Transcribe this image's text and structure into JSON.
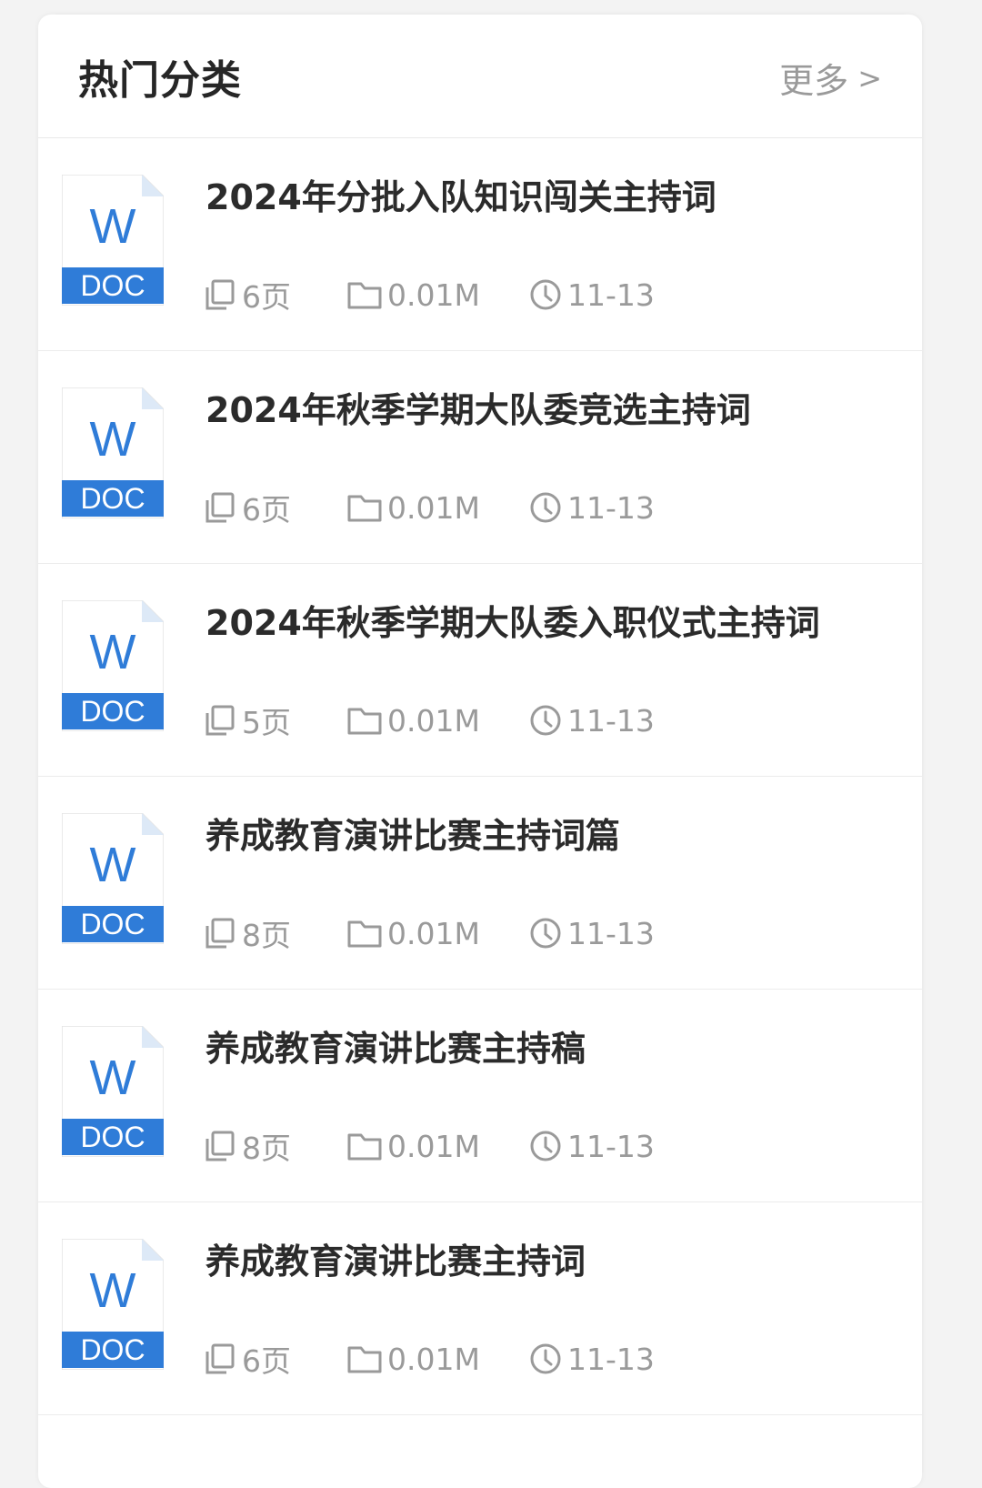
{
  "header": {
    "title": "热门分类",
    "more_label": "更多",
    "more_chevron": ">"
  },
  "icons": {
    "doc_letter": "W",
    "doc_label": "DOC",
    "doc_blue": "#2f7cd8",
    "doc_fold": "#dde9f7"
  },
  "items": [
    {
      "title": "2024年分批入队知识闯关主持词",
      "pages": "6页",
      "size": "0.01M",
      "date": "11-13"
    },
    {
      "title": "2024年秋季学期大队委竞选主持词",
      "pages": "6页",
      "size": "0.01M",
      "date": "11-13"
    },
    {
      "title": "2024年秋季学期大队委入职仪式主持词",
      "pages": "5页",
      "size": "0.01M",
      "date": "11-13"
    },
    {
      "title": "养成教育演讲比赛主持词篇",
      "pages": "8页",
      "size": "0.01M",
      "date": "11-13"
    },
    {
      "title": "养成教育演讲比赛主持稿",
      "pages": "8页",
      "size": "0.01M",
      "date": "11-13"
    },
    {
      "title": "养成教育演讲比赛主持词",
      "pages": "6页",
      "size": "0.01M",
      "date": "11-13"
    }
  ]
}
